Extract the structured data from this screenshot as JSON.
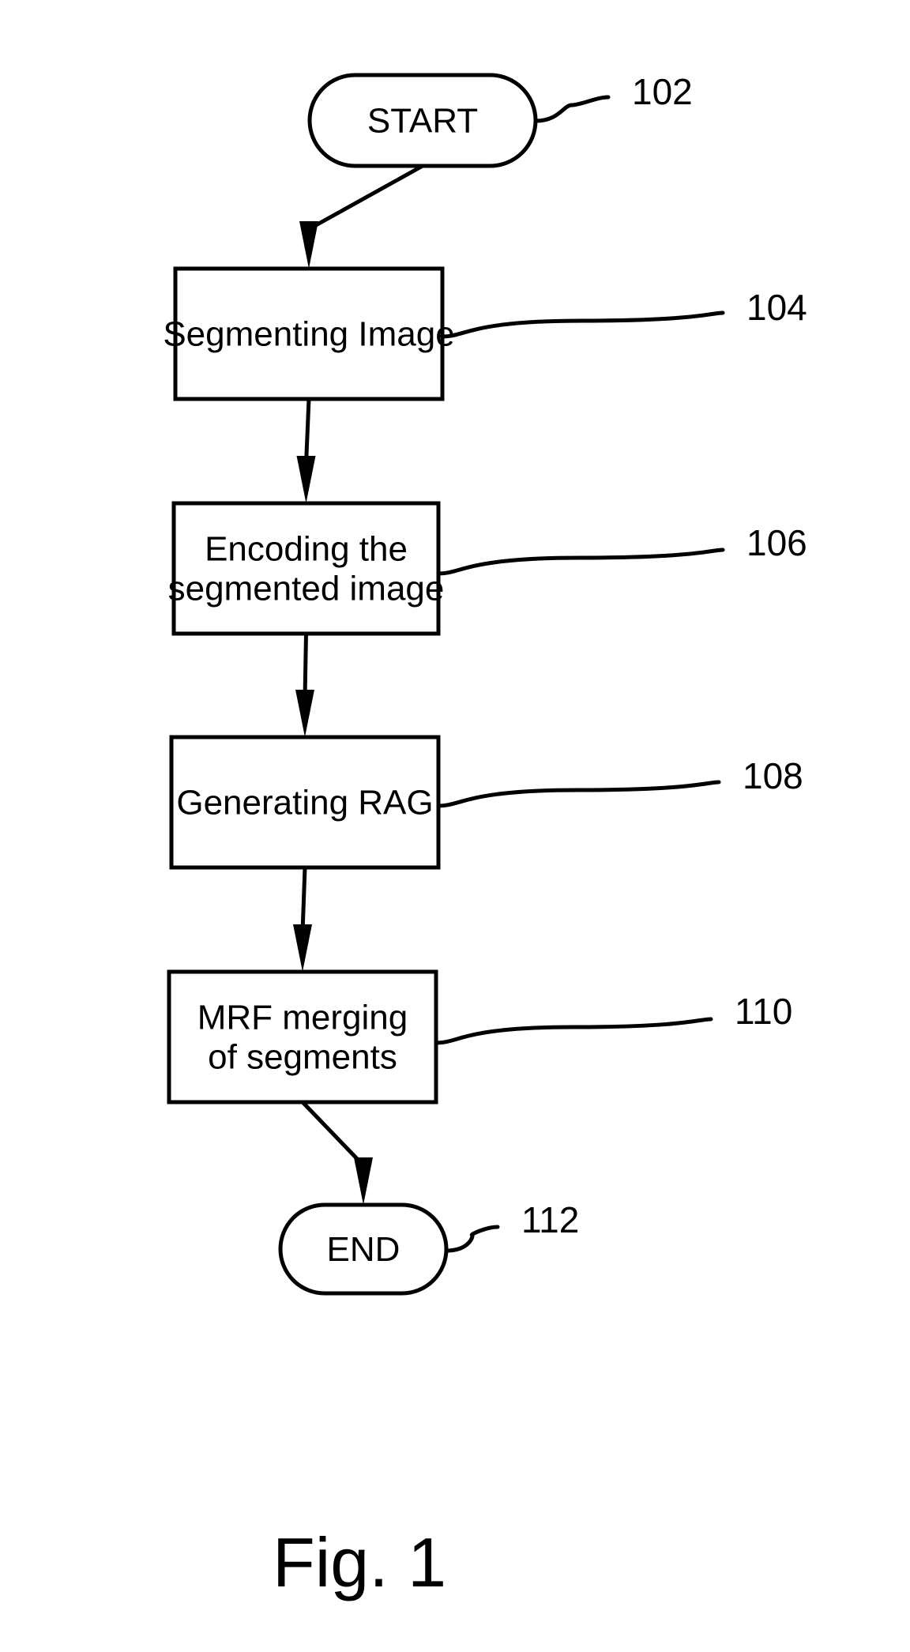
{
  "figure": {
    "caption": "Fig. 1",
    "type": "flowchart"
  },
  "nodes": [
    {
      "id": "start",
      "shape": "terminal",
      "ref": "102",
      "lines": [
        "START"
      ]
    },
    {
      "id": "segment",
      "shape": "process",
      "ref": "104",
      "lines": [
        "Segmenting Image"
      ]
    },
    {
      "id": "encode",
      "shape": "process",
      "ref": "106",
      "lines": [
        "Encoding the",
        "segmented image"
      ]
    },
    {
      "id": "rag",
      "shape": "process",
      "ref": "108",
      "lines": [
        "Generating RAG"
      ]
    },
    {
      "id": "merge",
      "shape": "process",
      "ref": "110",
      "lines": [
        "MRF merging",
        "of segments"
      ]
    },
    {
      "id": "end",
      "shape": "terminal",
      "ref": "112",
      "lines": [
        "END"
      ]
    }
  ],
  "edges": [
    {
      "from": "start",
      "to": "segment"
    },
    {
      "from": "segment",
      "to": "encode"
    },
    {
      "from": "encode",
      "to": "rag"
    },
    {
      "from": "rag",
      "to": "merge"
    },
    {
      "from": "merge",
      "to": "end"
    }
  ]
}
